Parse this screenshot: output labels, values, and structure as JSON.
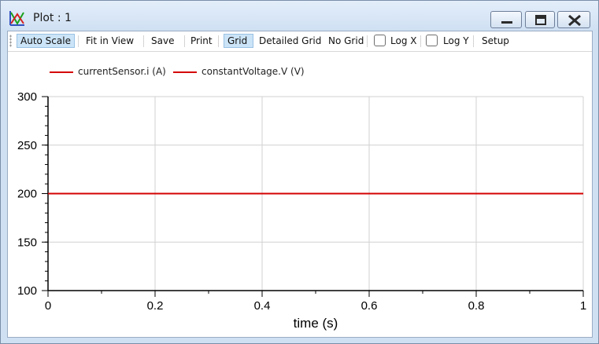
{
  "window": {
    "title": "Plot : 1"
  },
  "toolbar": {
    "auto_scale": "Auto Scale",
    "fit_in_view": "Fit in View",
    "save": "Save",
    "print": "Print",
    "grid": "Grid",
    "detailed_grid": "Detailed Grid",
    "no_grid": "No Grid",
    "log_x": "Log X",
    "log_y": "Log Y",
    "setup": "Setup",
    "log_x_checked": false,
    "log_y_checked": false,
    "auto_scale_pressed": true,
    "grid_pressed": true
  },
  "legend": [
    {
      "name": "currentSensor.i (A)",
      "color": "#d40000"
    },
    {
      "name": "constantVoltage.V (V)",
      "color": "#d40000"
    }
  ],
  "chart_data": {
    "type": "line",
    "xlabel": "time (s)",
    "ylabel": "",
    "xlim": [
      0,
      1
    ],
    "ylim": [
      100,
      300
    ],
    "x_ticks": [
      "0",
      "0.2",
      "0.4",
      "0.6",
      "0.8",
      "1"
    ],
    "y_ticks": [
      "100",
      "150",
      "200",
      "250",
      "300"
    ],
    "grid": true,
    "legend_position": "top-left",
    "series": [
      {
        "name": "currentSensor.i (A)",
        "color": "#d40000",
        "x": [
          0,
          1
        ],
        "y": [
          200,
          200
        ]
      },
      {
        "name": "constantVoltage.V (V)",
        "color": "#d40000",
        "x": [
          0,
          1
        ],
        "y": [
          200,
          200
        ]
      }
    ]
  }
}
